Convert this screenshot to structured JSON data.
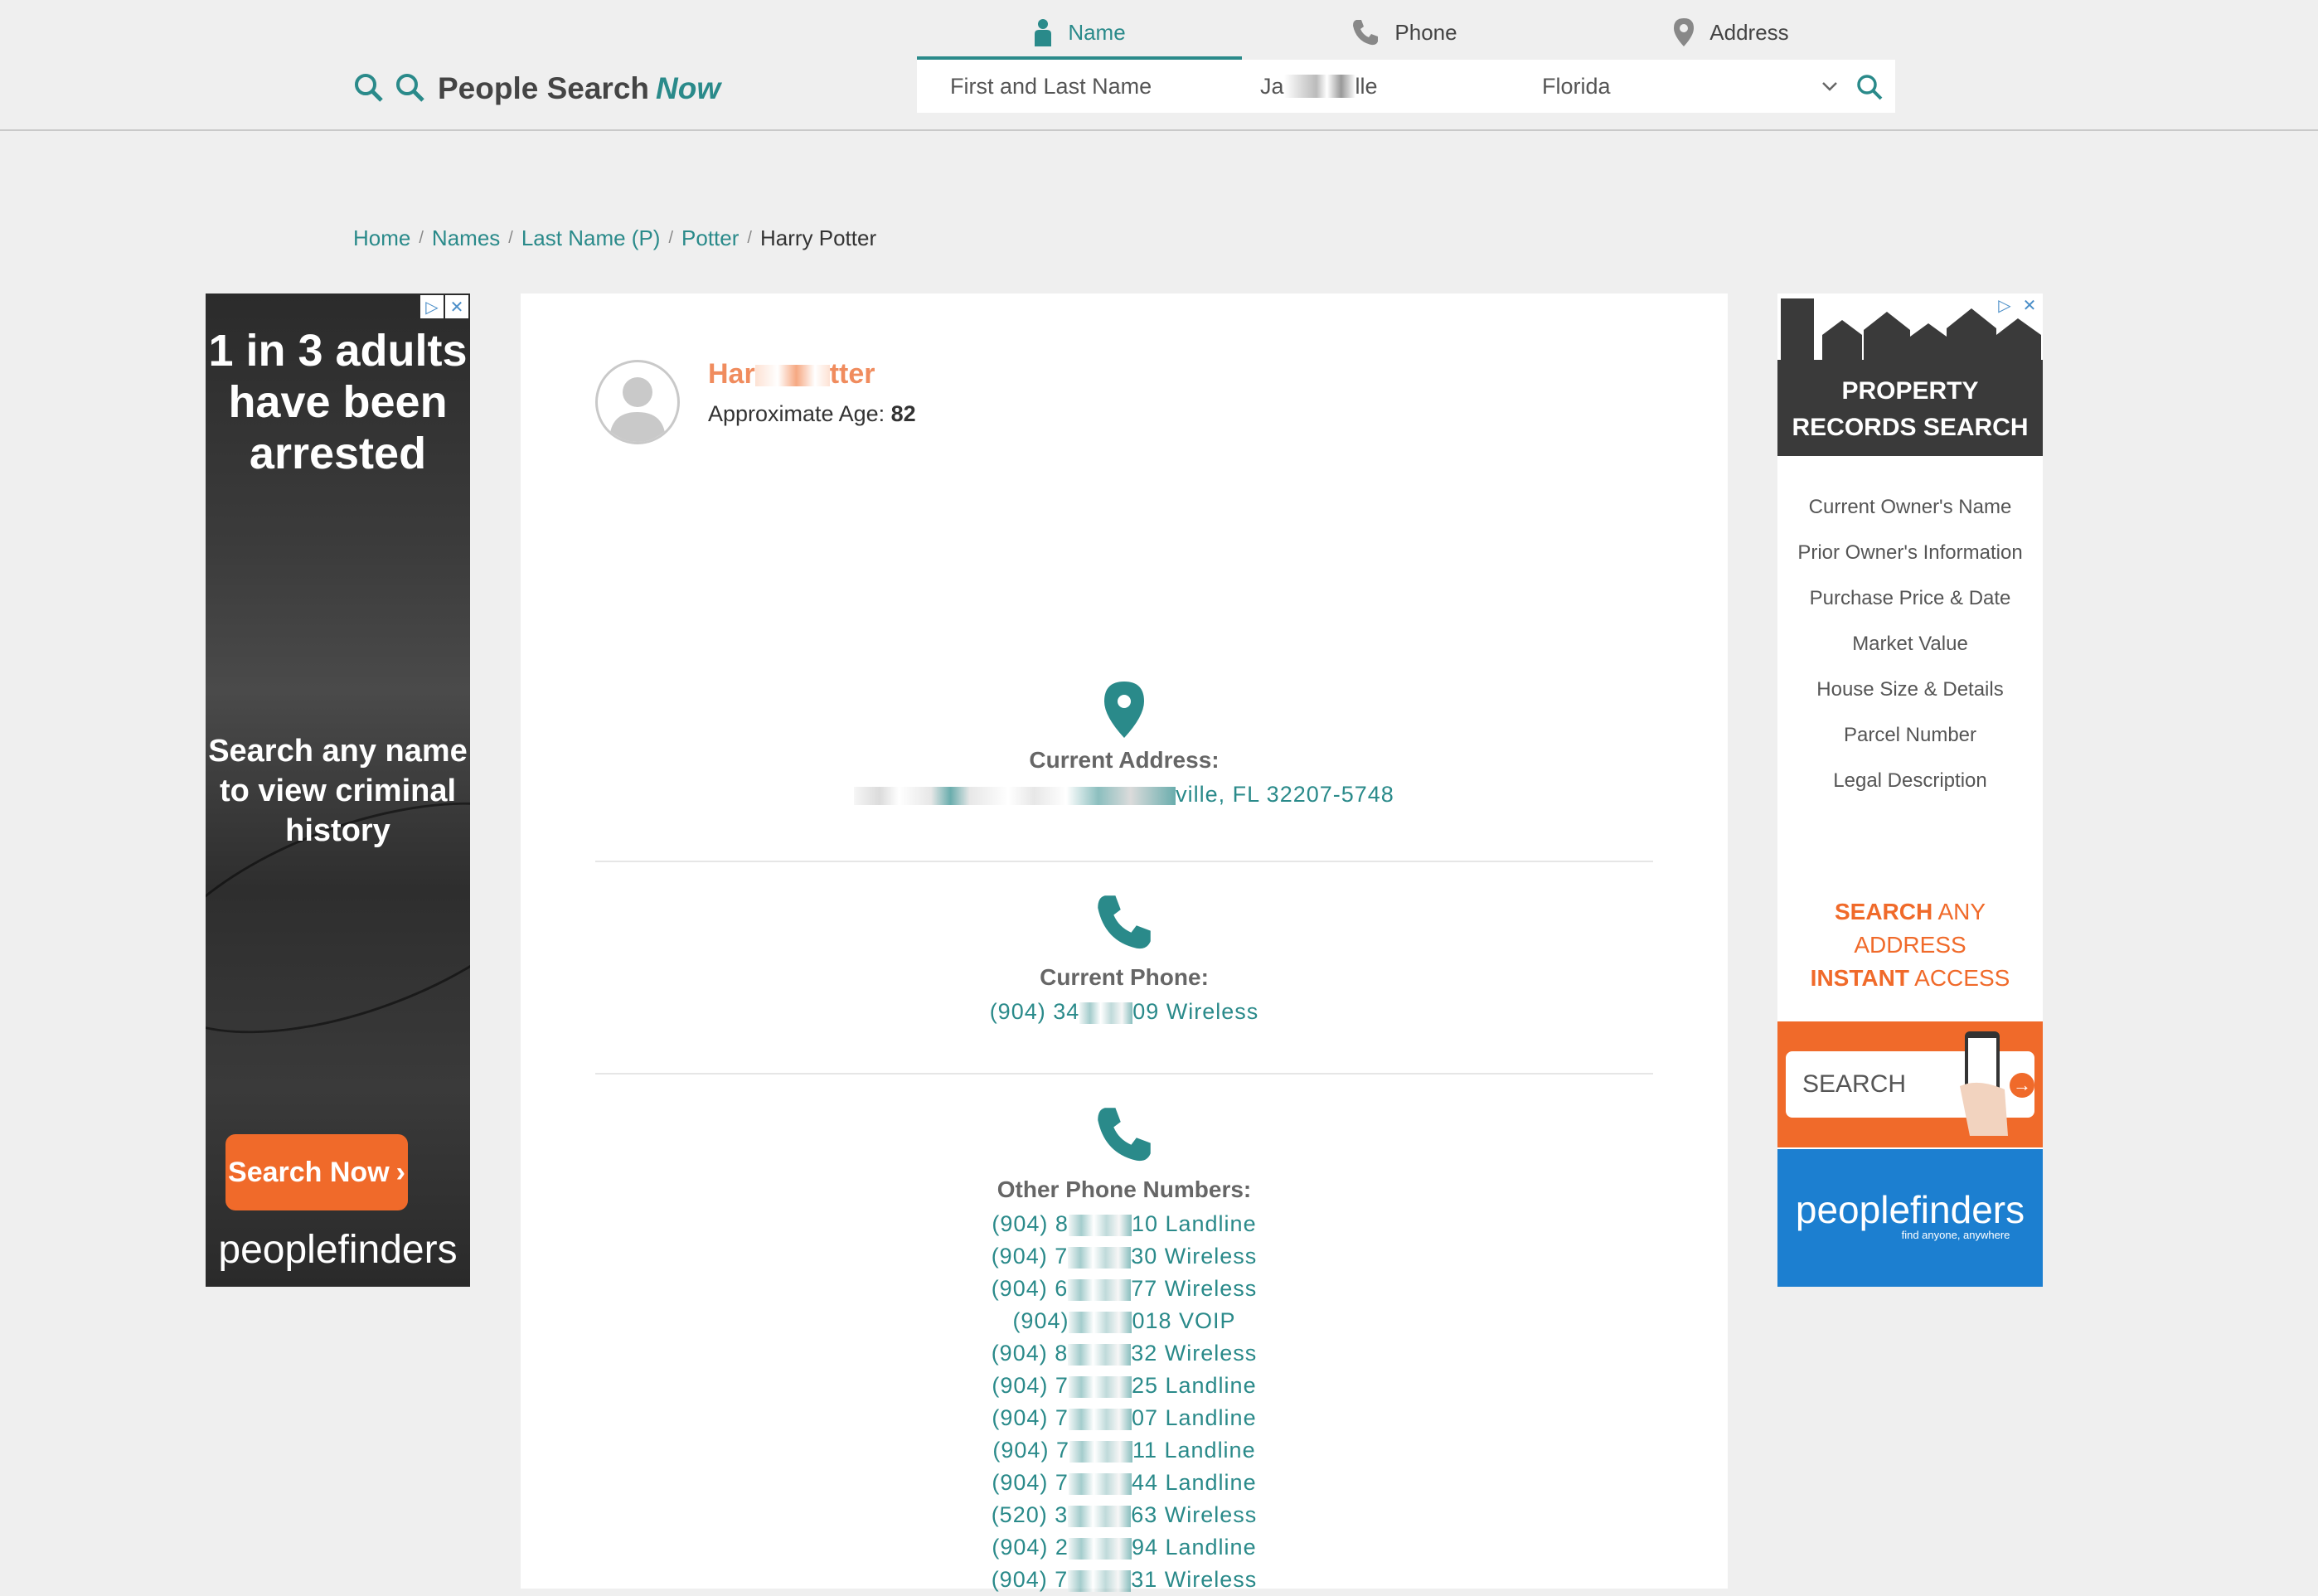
{
  "header": {
    "logo_main": "People Search",
    "logo_accent": "Now",
    "tabs": [
      {
        "label": "Name",
        "icon": "person-icon"
      },
      {
        "label": "Phone",
        "icon": "phone-icon"
      },
      {
        "label": "Address",
        "icon": "location-pin-icon"
      }
    ],
    "search": {
      "name_placeholder": "First and Last Name",
      "city_prefix": "Ja",
      "city_suffix": "lle",
      "state": "Florida"
    }
  },
  "breadcrumb": [
    "Home",
    "Names",
    "Last Name (P)",
    "Potter",
    "Harry Potter"
  ],
  "profile": {
    "name_prefix": "Har",
    "name_suffix": "tter",
    "age_label": "Approximate Age:",
    "age_value": "82"
  },
  "current_address": {
    "label": "Current Address:",
    "value_suffix": "ville, FL 32207-5748"
  },
  "current_phone": {
    "label": "Current Phone:",
    "prefix": "(904) 34",
    "suffix": "09 Wireless"
  },
  "other_phones": {
    "label": "Other Phone Numbers:",
    "items": [
      {
        "prefix": "(904) 8",
        "suffix": "10 Landline"
      },
      {
        "prefix": "(904) 7",
        "suffix": "30 Wireless"
      },
      {
        "prefix": "(904) 6",
        "suffix": "77 Wireless"
      },
      {
        "prefix": "(904)",
        "suffix": "018 VOIP"
      },
      {
        "prefix": "(904) 8",
        "suffix": "32 Wireless"
      },
      {
        "prefix": "(904) 7",
        "suffix": "25 Landline"
      },
      {
        "prefix": "(904) 7",
        "suffix": "07 Landline"
      },
      {
        "prefix": "(904) 7",
        "suffix": "11 Landline"
      },
      {
        "prefix": "(904) 7",
        "suffix": "44 Landline"
      },
      {
        "prefix": "(520) 3",
        "suffix": "63 Wireless"
      },
      {
        "prefix": "(904) 2",
        "suffix": "94 Landline"
      },
      {
        "prefix": "(904) 7",
        "suffix": "31 Wireless"
      }
    ]
  },
  "ad_left": {
    "headline": "1 in 3 adults have been arrested",
    "subline": "Search any name to view criminal history",
    "button": "Search Now",
    "brand": "peoplefinders"
  },
  "ad_right": {
    "title": "PROPERTY RECORDS SEARCH",
    "features": [
      "Current Owner's Name",
      "Prior Owner's Information",
      "Purchase Price & Date",
      "Market Value",
      "House Size & Details",
      "Parcel Number",
      "Legal Description"
    ],
    "cta_bold1": "SEARCH",
    "cta_rest1": "ANY",
    "cta_line2": "ADDRESS",
    "cta_bold3": "INSTANT",
    "cta_rest3": "ACCESS",
    "search_placeholder": "SEARCH",
    "brand": "peoplefinders",
    "tagline": "find anyone, anywhere"
  },
  "colors": {
    "accent": "#2a8a8a",
    "name": "#f08c5e",
    "ad_orange": "#f06a2a",
    "ad_blue": "#1c7fd0"
  }
}
